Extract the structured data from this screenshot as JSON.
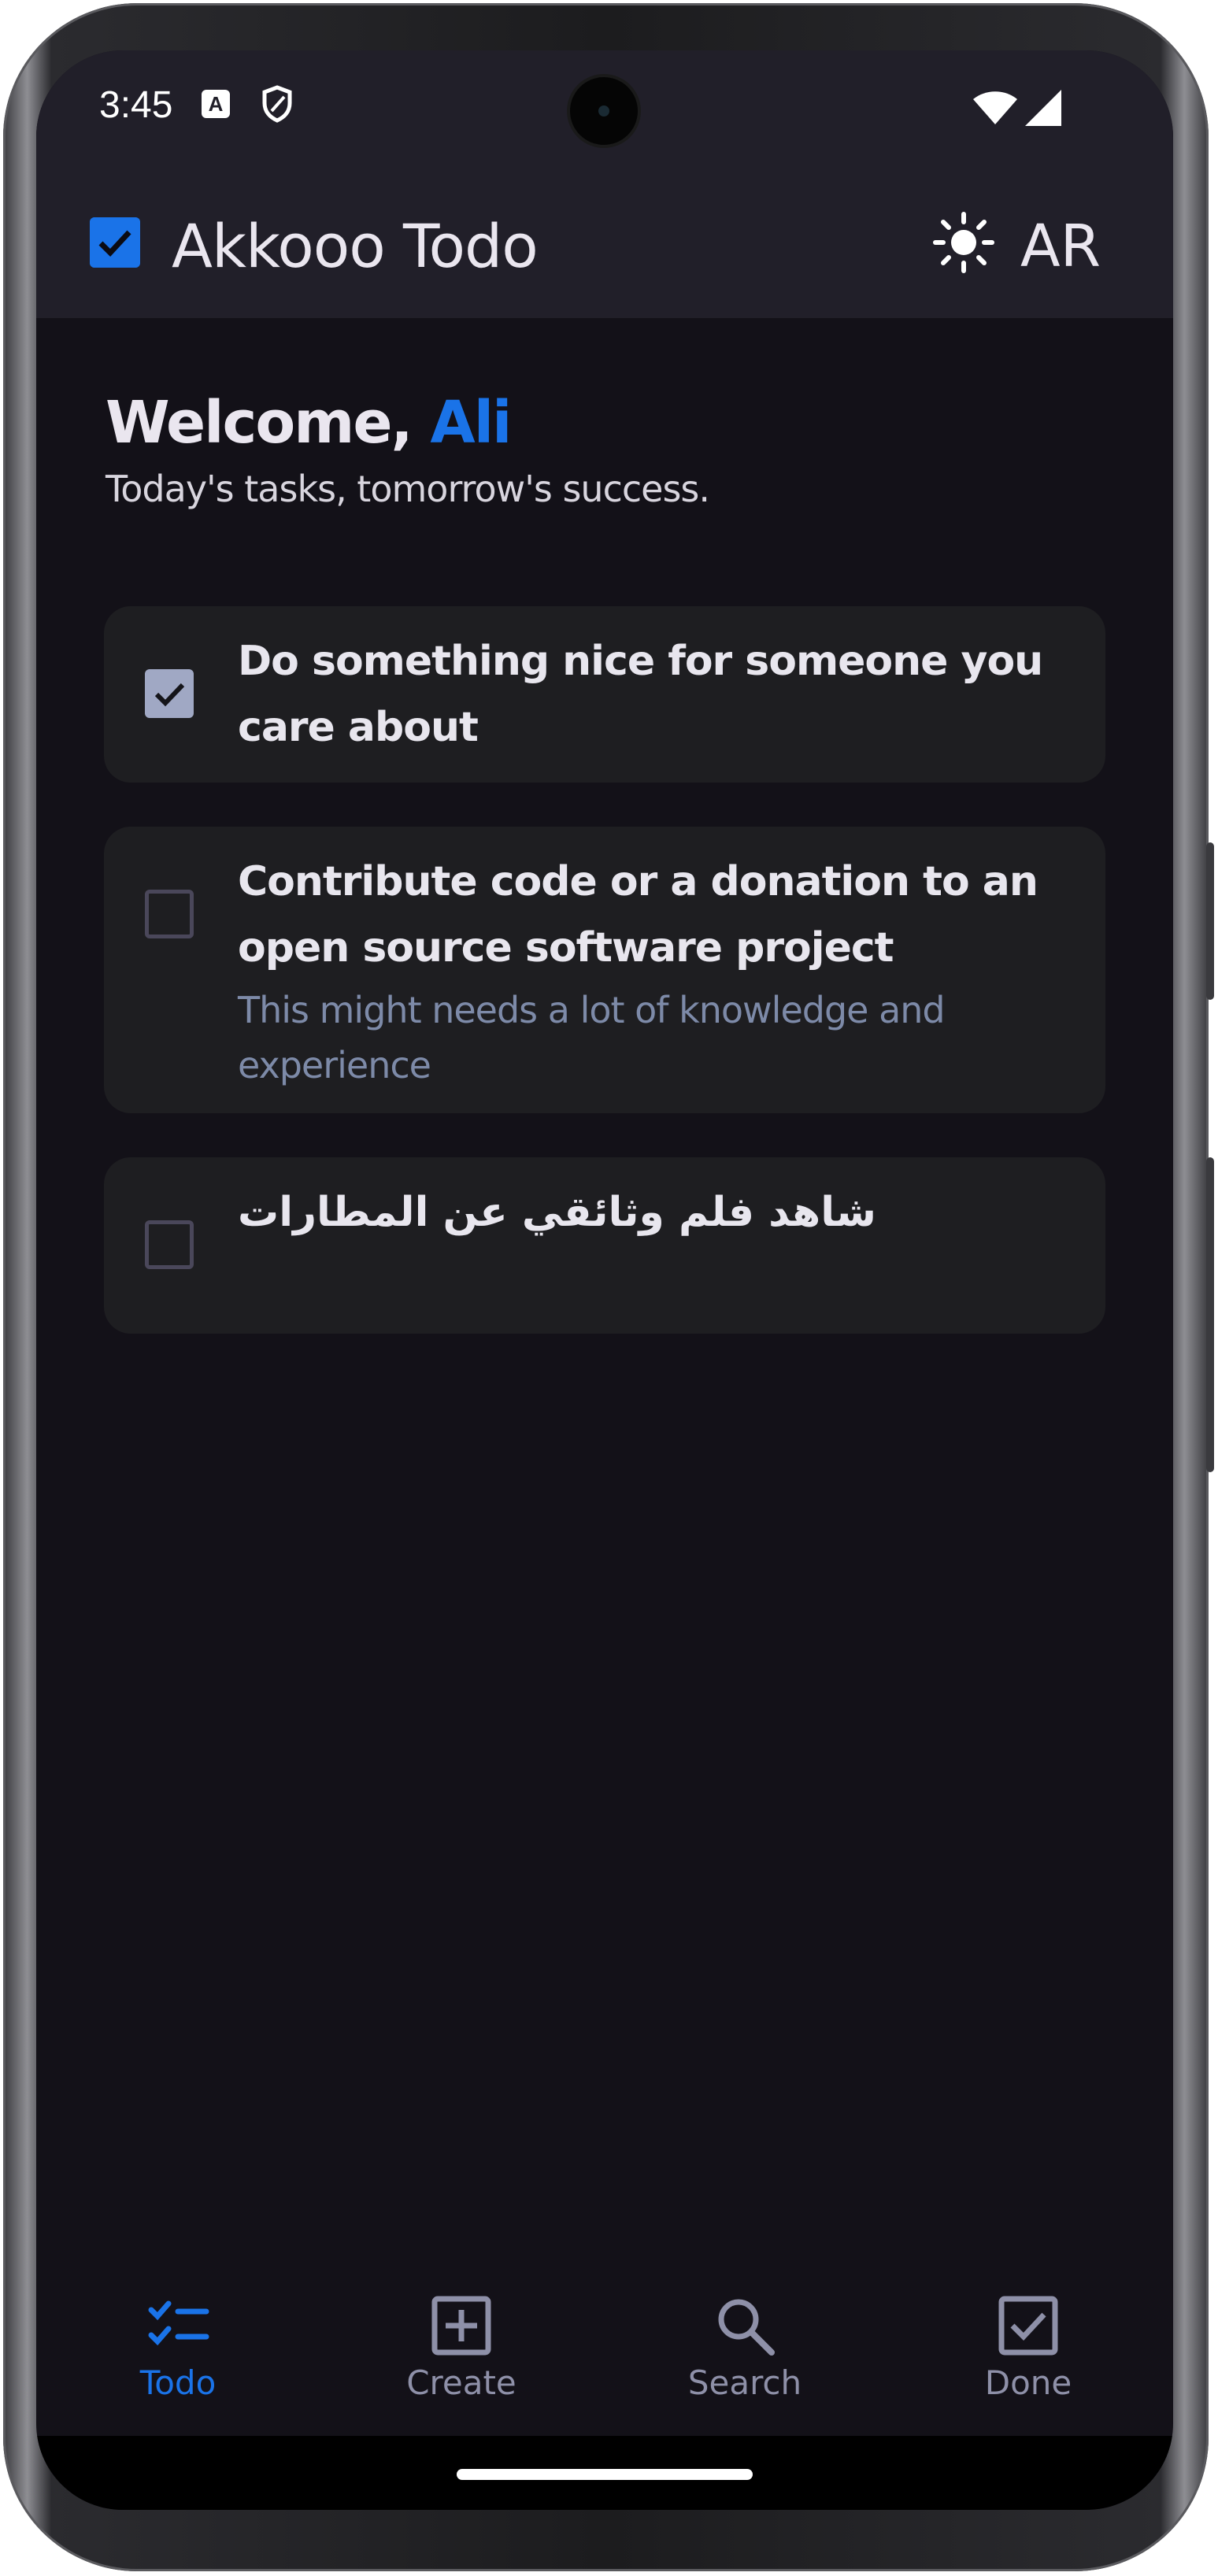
{
  "status_bar": {
    "time": "3:45",
    "notification_icon_letter": "A",
    "icons": [
      "a-notification-icon",
      "shield-icon",
      "wifi-icon",
      "signal-icon"
    ]
  },
  "app_bar": {
    "title": "Akkooo Todo",
    "theme_icon": "sun-icon",
    "language_label": "AR",
    "logo_icon": "checkbox-checked-icon"
  },
  "welcome": {
    "greeting": "Welcome,",
    "name": "Ali",
    "tagline": "Today's tasks, tomorrow's success."
  },
  "tasks": [
    {
      "title": "Do something nice for someone you care about",
      "description": "",
      "done": true
    },
    {
      "title": "Contribute code or a  donation to an open source software project",
      "description": "This might needs a lot of knowledge and experience",
      "done": false
    },
    {
      "title": "شاهد فلم وثائقي عن المطارات",
      "description": "",
      "done": false
    }
  ],
  "bottom_nav": {
    "active": "Todo",
    "items": [
      {
        "label": "Todo",
        "icon": "checklist-icon"
      },
      {
        "label": "Create",
        "icon": "add-box-icon"
      },
      {
        "label": "Search",
        "icon": "search-icon"
      },
      {
        "label": "Done",
        "icon": "check-box-icon"
      }
    ]
  },
  "colors": {
    "accent": "#1a73e8",
    "background": "#131118",
    "app_bar": "#211f29",
    "card": "#1e1e21",
    "description_text": "#7d8aa8",
    "nav_inactive": "#8e90a8"
  }
}
